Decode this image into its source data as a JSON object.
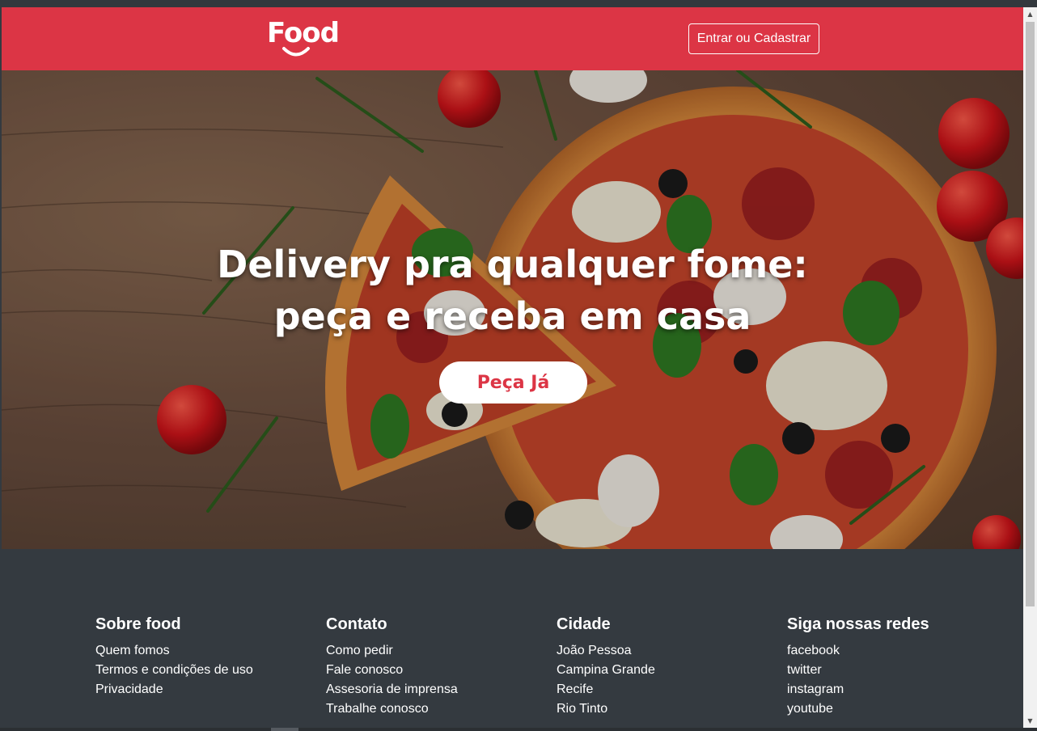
{
  "header": {
    "logo_text": "Food",
    "login_label": "Entrar ou Cadastrar",
    "brand_color": "#dc3545"
  },
  "hero": {
    "title_line1": "Delivery pra qualquer fome:",
    "title_line2": "peça e receba em casa",
    "cta_label": "Peça Já"
  },
  "footer": {
    "columns": [
      {
        "title": "Sobre food",
        "links": [
          "Quem fomos",
          "Termos e condições de uso",
          "Privacidade"
        ]
      },
      {
        "title": "Contato",
        "links": [
          "Como pedir",
          "Fale conosco",
          "Assesoria de imprensa",
          "Trabalhe conosco"
        ]
      },
      {
        "title": "Cidade",
        "links": [
          "João Pessoa",
          "Campina Grande",
          "Recife",
          "Rio Tinto"
        ]
      },
      {
        "title": "Siga nossas redes",
        "links": [
          "facebook",
          "twitter",
          "instagram",
          "youtube"
        ]
      }
    ],
    "background_color": "#343a40"
  },
  "icons": {
    "scroll_up": "scroll-up-arrow-icon",
    "scroll_down": "scroll-down-arrow-icon"
  }
}
